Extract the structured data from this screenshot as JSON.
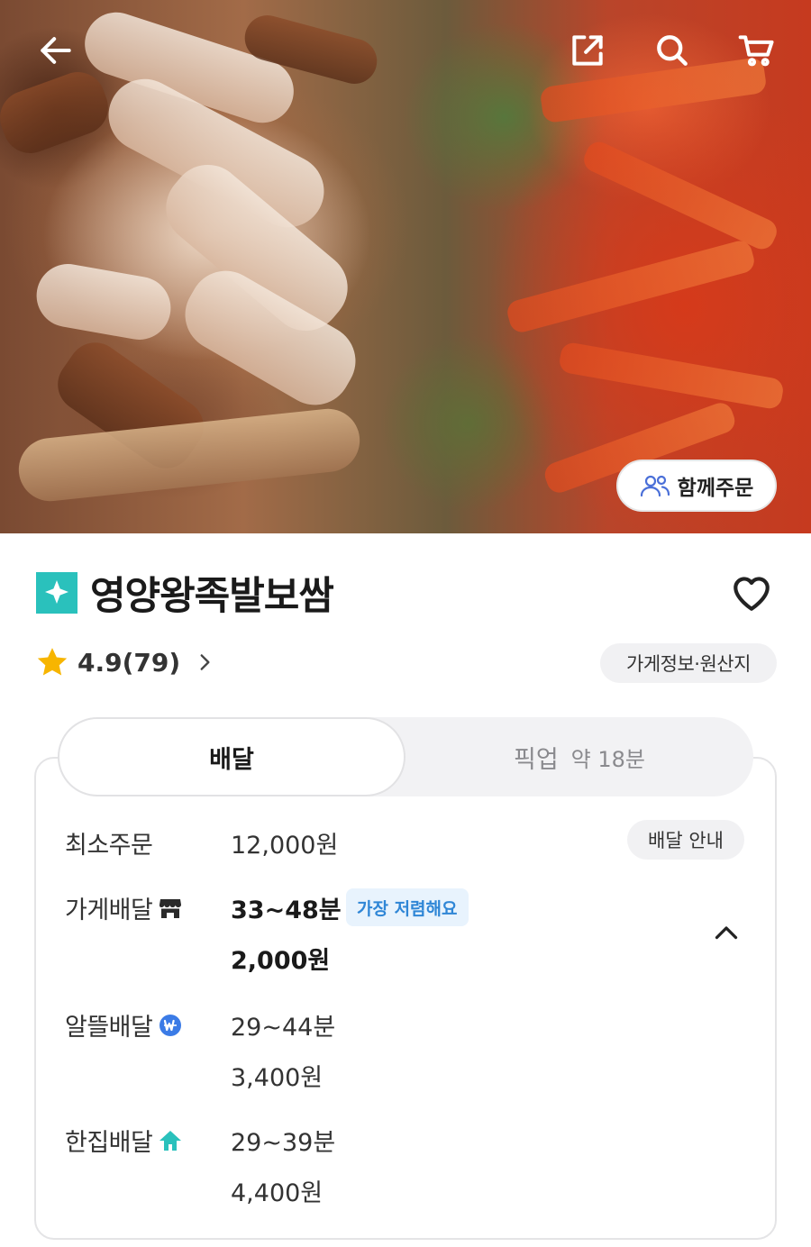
{
  "hero": {
    "together_order_label": "함께주문"
  },
  "store": {
    "name": "영양왕족발보쌈",
    "rating": "4.9(79)",
    "info_chip_label": "가게정보·원산지"
  },
  "tabs": {
    "delivery_label": "배달",
    "pickup_label": "픽업",
    "pickup_time": "약 18분"
  },
  "delivery": {
    "min_order_label": "최소주문",
    "min_order_value": "12,000원",
    "guide_label": "배달 안내",
    "options": [
      {
        "label": "가게배달",
        "time": "33~48분",
        "fee": "2,000원",
        "badge": "가장 저렴해요"
      },
      {
        "label": "알뜰배달",
        "time": "29~44분",
        "fee": "3,400원"
      },
      {
        "label": "한집배달",
        "time": "29~39분",
        "fee": "4,400원"
      }
    ]
  },
  "colors": {
    "brand_mint": "#2ac1bc",
    "badge_blue": "#2f86d6",
    "star_yellow": "#f7b500"
  },
  "icons": [
    "back-arrow-icon",
    "share-icon",
    "search-icon",
    "cart-icon",
    "people-icon",
    "store-badge-icon",
    "heart-icon",
    "star-icon",
    "chevron-right-icon",
    "store-delivery-icon",
    "saver-delivery-icon",
    "single-delivery-icon",
    "chevron-up-icon"
  ]
}
